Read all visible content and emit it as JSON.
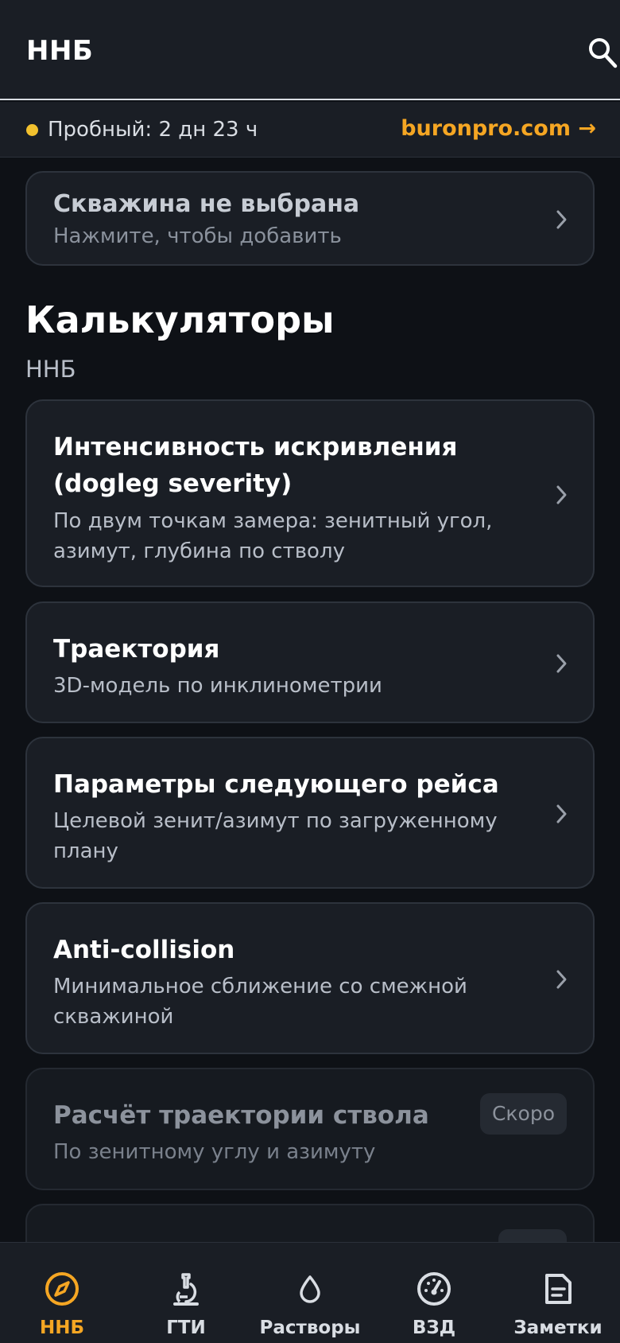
{
  "app_bar": {
    "title": "ННБ",
    "search_icon": "search-icon"
  },
  "trial": {
    "status": "Пробный: 2 дн 23 ч",
    "link": "buronpro.com →",
    "dot_color": "#f2c12e"
  },
  "well_selector": {
    "title": "Скважина не выбрана",
    "subtitle": "Нажмите, чтобы добавить"
  },
  "section": {
    "title": "Калькуляторы",
    "subtitle": "ННБ"
  },
  "calculators": [
    {
      "title_line1": "Интенсивность искривления",
      "title_line2": "(dogleg severity)",
      "desc_line1": "По двум точкам замера: зенитный угол,",
      "desc_line2": "азимут, глубина по стволу"
    },
    {
      "title": "Траектория",
      "desc": "3D-модель по инклинометрии"
    },
    {
      "title": "Параметры следующего рейса",
      "desc_line1": "Целевой зенит/азимут по загруженному",
      "desc_line2": "плану"
    },
    {
      "title": "Anti-collision",
      "desc_line1": "Минимальное сближение со смежной",
      "desc_line2": "скважиной"
    },
    {
      "title": "Расчёт траектории ствола",
      "desc": "По зенитному углу и азимуту",
      "badge": "Скоро",
      "disabled": true
    }
  ],
  "bottom_nav": [
    {
      "label": "ННБ",
      "icon": "compass-icon",
      "active": true
    },
    {
      "label": "ГТИ",
      "icon": "microscope-icon",
      "active": false
    },
    {
      "label": "Растворы",
      "icon": "drop-icon",
      "active": false
    },
    {
      "label": "ВЗД",
      "icon": "gauge-icon",
      "active": false
    },
    {
      "label": "Заметки",
      "icon": "note-icon",
      "active": false
    }
  ],
  "colors": {
    "accent": "#f5a623",
    "background": "#0e1116",
    "card": "#1a1e25"
  }
}
